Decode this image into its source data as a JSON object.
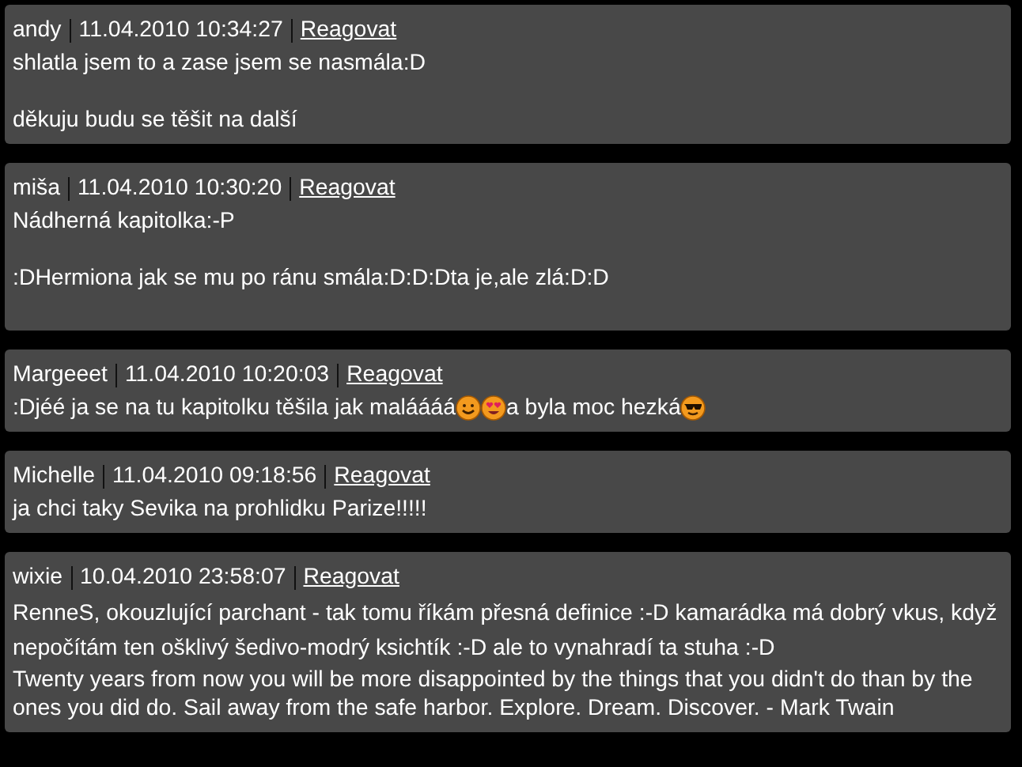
{
  "comments": [
    {
      "author": "andy",
      "date": "11.04.2010 10:34:27",
      "reply": "Reagovat",
      "body": [
        {
          "kind": "text",
          "text": "shlatla jsem to a zase jsem se nasmála:D"
        },
        {
          "kind": "break"
        },
        {
          "kind": "text",
          "text": "děkuju budu se těšit na další"
        }
      ]
    },
    {
      "author": "miša",
      "date": "11.04.2010 10:30:20",
      "reply": "Reagovat",
      "body": [
        {
          "kind": "text",
          "text": "Nádherná kapitolka:-P"
        },
        {
          "kind": "break"
        },
        {
          "kind": "text",
          "text": ":DHermiona jak se mu po ránu smála:D:D:Dta je,ale zlá:D:D"
        },
        {
          "kind": "break"
        }
      ]
    },
    {
      "author": "Margeeet",
      "date": "11.04.2010 10:20:03",
      "reply": "Reagovat",
      "body": [
        {
          "kind": "mixed",
          "parts": [
            {
              "kind": "text",
              "text": ":Djéé ja se na tu kapitolku těšila jak maláááá"
            },
            {
              "kind": "smile"
            },
            {
              "kind": "love"
            },
            {
              "kind": "text",
              "text": "a byla moc hezká"
            },
            {
              "kind": "cool"
            }
          ]
        }
      ]
    },
    {
      "author": "Michelle",
      "date": "11.04.2010 09:18:56",
      "reply": "Reagovat",
      "body": [
        {
          "kind": "text",
          "text": "ja chci taky Sevika na prohlidku Parize!!!!!"
        }
      ]
    },
    {
      "author": "wixie",
      "date": "10.04.2010 23:58:07",
      "reply": "Reagovat",
      "body": [
        {
          "kind": "spaced",
          "text": "RenneS, okouzlující parchant - tak tomu říkám přesná definice :-D kamarádka má dobrý vkus, když nepočítám ten ošklivý šedivo-modrý ksichtík :-D ale to vynahradí ta stuha :-D"
        },
        {
          "kind": "text",
          "text": "Twenty years from now you will be more disappointed by the things that you didn't do than by the ones you did do. Sail away from the safe harbor. Explore. Dream. Discover. - Mark Twain"
        }
      ]
    }
  ]
}
